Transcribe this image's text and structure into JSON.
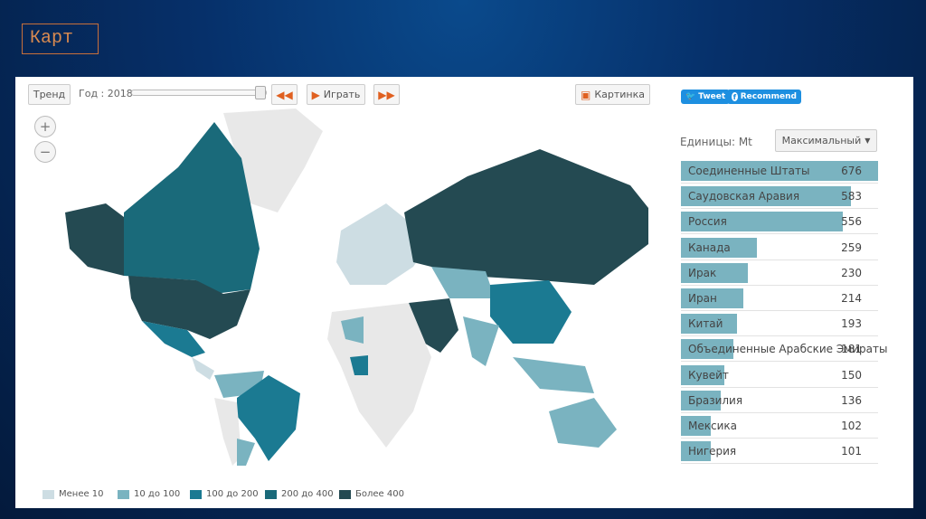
{
  "slide_title": "Карт",
  "toolbar": {
    "trend": "Тренд",
    "year_label": "Год : 2018",
    "year_progress": 1.0,
    "play": "Играть",
    "picture": "Картинка"
  },
  "social": {
    "tweet": "Tweet",
    "recommend": "Recommend"
  },
  "units": "Единицы: Mt",
  "dropdown": "Максимальный",
  "zoom": {
    "in": "+",
    "out": "−"
  },
  "ranking": [
    {
      "name": "Соединенные Штаты",
      "value": 676
    },
    {
      "name": "Саудовская Аравия",
      "value": 583
    },
    {
      "name": "Россия",
      "value": 556
    },
    {
      "name": "Канада",
      "value": 259
    },
    {
      "name": "Ирак",
      "value": 230
    },
    {
      "name": "Иран",
      "value": 214
    },
    {
      "name": "Китай",
      "value": 193
    },
    {
      "name": "Объединенные Арабские Эмираты",
      "value": 181
    },
    {
      "name": "Кувейт",
      "value": 150
    },
    {
      "name": "Бразилия",
      "value": 136
    },
    {
      "name": "Мексика",
      "value": 102
    },
    {
      "name": "Нигерия",
      "value": 101
    }
  ],
  "legend": [
    {
      "label": "Менее 10",
      "color": "#cddde3"
    },
    {
      "label": "10 до 100",
      "color": "#7ab3c0"
    },
    {
      "label": "100 до 200",
      "color": "#1b7a92"
    },
    {
      "label": "200 до 400",
      "color": "#1a6a7a"
    },
    {
      "label": "Более 400",
      "color": "#244a52"
    }
  ]
}
